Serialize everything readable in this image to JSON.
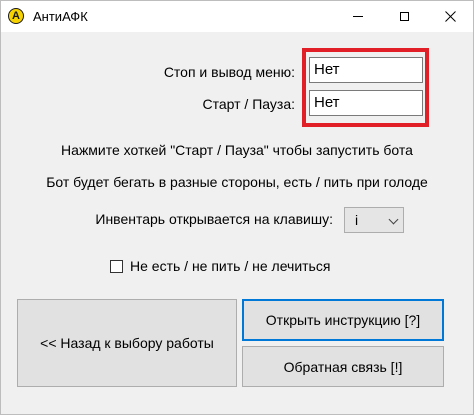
{
  "window": {
    "title": "АнтиАФК",
    "app_icon_glyph": "A"
  },
  "settings": {
    "stop_label": "Стоп и вывод меню:",
    "stop_value": "Нет",
    "start_label": "Старт / Пауза:",
    "start_value": "Нет"
  },
  "info": {
    "line1": "Нажмите хоткей \"Старт / Пауза\" чтобы запустить бота",
    "line2": "Бот будет бегать в разные стороны, есть / пить при голоде"
  },
  "inventory": {
    "label": "Инвентарь открывается на клавишу:",
    "selected": "i"
  },
  "option": {
    "no_eat_label": "Не есть / не пить / не лечиться",
    "checked": false
  },
  "buttons": {
    "back": "<< Назад к выбору работы",
    "instructions": "Открыть инструкцию [?]",
    "feedback": "Обратная связь [!]"
  },
  "colors": {
    "highlight": "#e11f26",
    "focus_border": "#0078d7",
    "icon_yellow": "#f6d300"
  }
}
